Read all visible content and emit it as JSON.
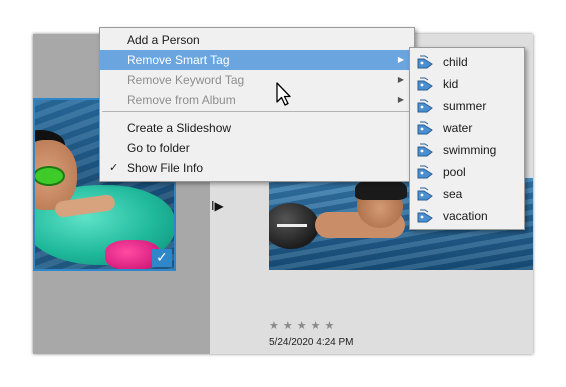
{
  "context_menu": {
    "items": [
      {
        "label": "Add a Person",
        "state": "normal"
      },
      {
        "label": "Remove Smart Tag",
        "state": "highlighted",
        "submenu": true
      },
      {
        "label": "Remove Keyword Tag",
        "state": "disabled",
        "submenu": true
      },
      {
        "label": "Remove from Album",
        "state": "disabled",
        "submenu": true
      },
      {
        "label": "Create a Slideshow",
        "state": "normal"
      },
      {
        "label": "Go to folder",
        "state": "normal"
      },
      {
        "label": "Show File Info",
        "state": "checked"
      }
    ],
    "check_glyph": "✓",
    "submenu_arrow": "▶"
  },
  "smart_tags": {
    "items": [
      "child",
      "kid",
      "summer",
      "water",
      "swimming",
      "pool",
      "sea",
      "vacation"
    ],
    "icon": "smart-tag-icon"
  },
  "thumbnail": {
    "rating_stars": "★★★★★",
    "date": "5/24/2020 4:24 PM",
    "selected_check": "✓",
    "play_glyph": "I▶"
  },
  "colors": {
    "highlight": "#6aa5e0",
    "selection_border": "#2f86c8"
  }
}
